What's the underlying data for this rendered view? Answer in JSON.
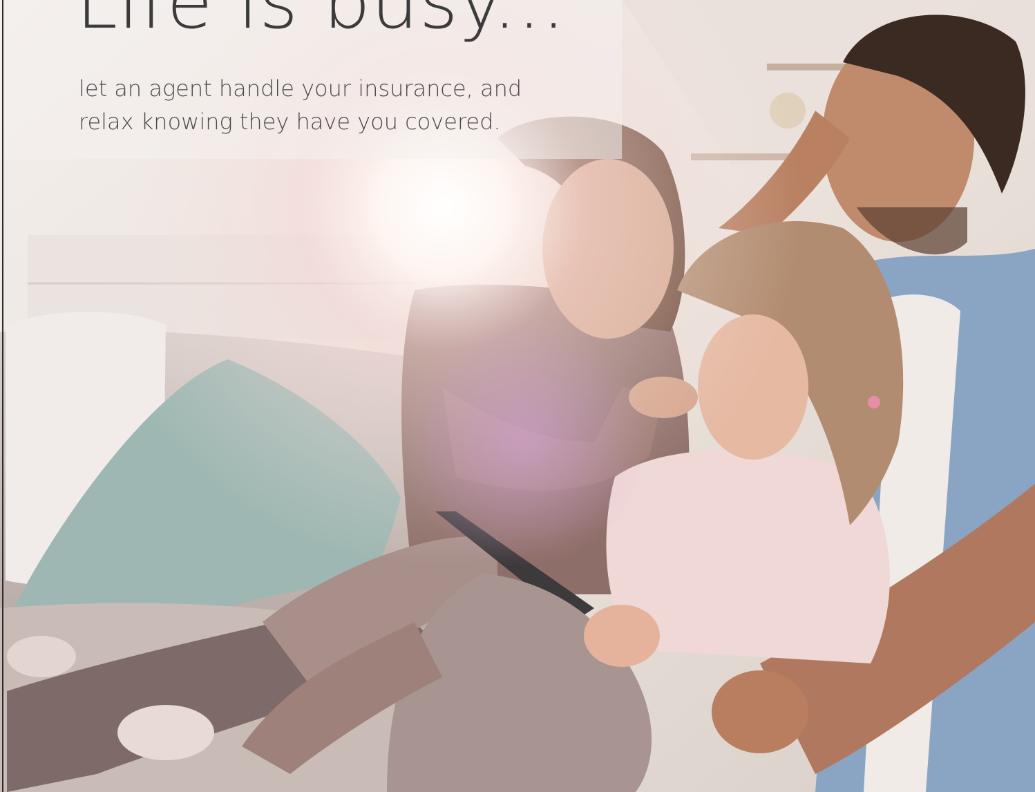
{
  "headline": "Life is busy...",
  "subhead": {
    "line1": "let an agent handle your insurance, and",
    "line2": "relax knowing they have you covered."
  },
  "colors": {
    "text_dark": "#3b3b3b",
    "text_body": "#4a4a4a",
    "background_warm": "#f4efeb",
    "cushion_teal": "#9fb7b2",
    "shirt_blue": "#8aa4c4"
  },
  "photo": {
    "subject": "family-on-sofa-photo"
  }
}
